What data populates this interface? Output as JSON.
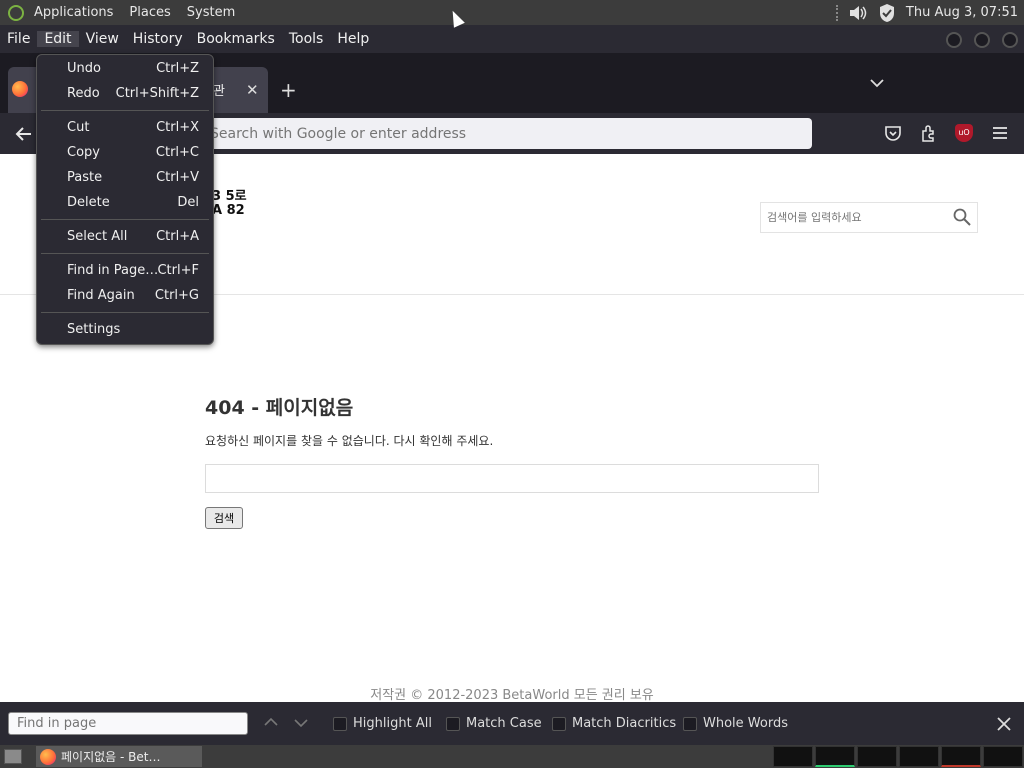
{
  "top_panel": {
    "menus": [
      "Applications",
      "Places",
      "System"
    ],
    "clock": "Thu Aug  3, 07:51"
  },
  "menubar": {
    "items": [
      "File",
      "Edit",
      "View",
      "History",
      "Bookmarks",
      "Tools",
      "Help"
    ]
  },
  "tab": {
    "title_fragment": "관",
    "close_glyph": "✕"
  },
  "nav": {
    "address_placeholder": "Search with Google or enter address"
  },
  "edit_menu": {
    "items": [
      {
        "label": "Undo",
        "shortcut": "Ctrl+Z"
      },
      {
        "label": "Redo",
        "shortcut": "Ctrl+Shift+Z"
      },
      {
        "label": "Cut",
        "shortcut": "Ctrl+X"
      },
      {
        "label": "Copy",
        "shortcut": "Ctrl+C"
      },
      {
        "label": "Paste",
        "shortcut": "Ctrl+V"
      },
      {
        "label": "Delete",
        "shortcut": "Del"
      },
      {
        "label": "Select All",
        "shortcut": "Ctrl+A"
      },
      {
        "label": "Find in Page…",
        "shortcut": "Ctrl+F"
      },
      {
        "label": "Find Again",
        "shortcut": "Ctrl+G"
      },
      {
        "label": "Settings",
        "shortcut": ""
      }
    ]
  },
  "page": {
    "logo_line1": "3 5로",
    "logo_line2": "A 82",
    "search_placeholder": "검색어를 입력하세요",
    "error_title": "404 - 페이지없음",
    "error_message": "요청하신 페이지를 찾을 수 없습니다. 다시 확인해 주세요.",
    "button_label": "검색",
    "footer": "저작권 © 2012-2023 BetaWorld 모든 권리 보유"
  },
  "findbar": {
    "placeholder": "Find in page",
    "options": [
      "Highlight All",
      "Match Case",
      "Match Diacritics",
      "Whole Words"
    ]
  },
  "taskbar": {
    "item_label": "페이지없음 - Bet…"
  },
  "colors": {
    "panel": "#3c3c3c",
    "chrome_dark": "#2b2a33",
    "tabstrip": "#1c1b22",
    "ublock": "#b0192b"
  }
}
